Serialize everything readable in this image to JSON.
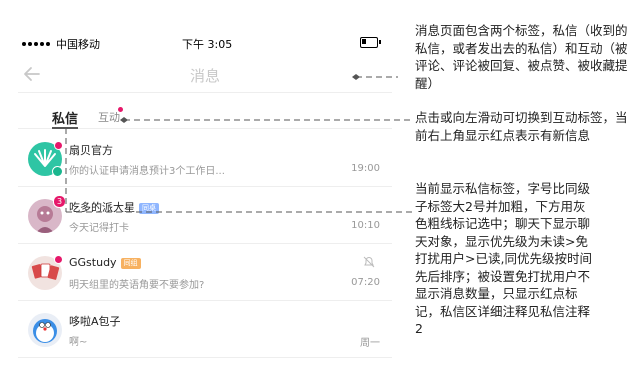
{
  "status_bar": {
    "carrier": "中国移动",
    "time": "下午 3:05"
  },
  "nav": {
    "title": "消息"
  },
  "tabs": {
    "private_label": "私信",
    "interact_label": "互动"
  },
  "conversations": [
    {
      "name": "扇贝官方",
      "message": "你的认证申请消息预计3个工作日...",
      "time": "19:00",
      "tag": ""
    },
    {
      "name": "吃多的派大星",
      "message": "今天记得打卡",
      "time": "10:10",
      "tag": "同桌",
      "badge": "3"
    },
    {
      "name": "GGstudy",
      "message": "明天组里的英语角要不要参加?",
      "time": "07:20",
      "tag": "同组"
    },
    {
      "name": "哆啦A包子",
      "message": "啊~",
      "time": "周一",
      "tag": ""
    }
  ],
  "annotations": {
    "tabs_note": "消息页面包含两个标签，私信（收到的私信，或者发出去的私信）和互动（被评论、评论被回复、被点赞、被收藏提醒）",
    "switch_note": "点击或向左滑动可切换到互动标签，当前右上角显示红点表示有新信息",
    "private_note": "当前显示私信标签，字号比同级子标签大2号并加粗，下方用灰色粗线标记选中；聊天下显示聊天对象，显示优先级为未读>免打扰用户>已读,同优先级按时间先后排序；被设置免打扰用户不显示消息数量，只显示红点标记，私信区详细注释见私信注释2"
  },
  "colors": {
    "accent_red": "#e6186a",
    "tag_blue": "#8fb6ff",
    "tag_orange": "#f7b160",
    "verified_green": "#19b68e"
  }
}
